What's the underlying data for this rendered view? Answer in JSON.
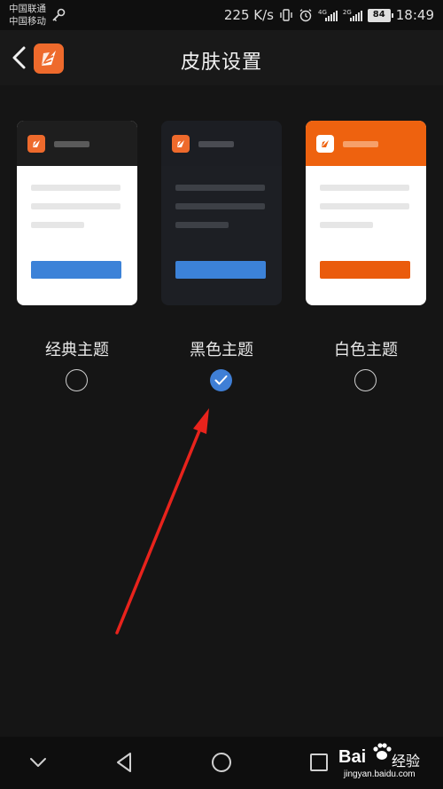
{
  "status_bar": {
    "carrier_1": "中国联通",
    "carrier_2": "中国移动",
    "speed": "225 K/s",
    "net_tag_1": "4G",
    "net_tag_2": "2G",
    "battery": "84",
    "time": "18:49"
  },
  "header": {
    "title": "皮肤设置",
    "back_icon": "chevron-left-icon",
    "logo_icon": "app-logo-icon"
  },
  "themes": [
    {
      "name": "经典主题",
      "selected": false
    },
    {
      "name": "黑色主题",
      "selected": true
    },
    {
      "name": "白色主题",
      "selected": false
    }
  ],
  "navbar": {
    "icons": [
      "chevron-down-icon",
      "back-triangle-icon",
      "home-circle-icon",
      "recents-square-icon"
    ]
  },
  "watermark": {
    "brand": "Bai",
    "brand_cn": "经验",
    "url": "jingyan.baidu.com"
  },
  "colors": {
    "accent_blue": "#3c82d8",
    "brand_orange": "#ee6a2c",
    "annotation_red": "#e8231c"
  }
}
